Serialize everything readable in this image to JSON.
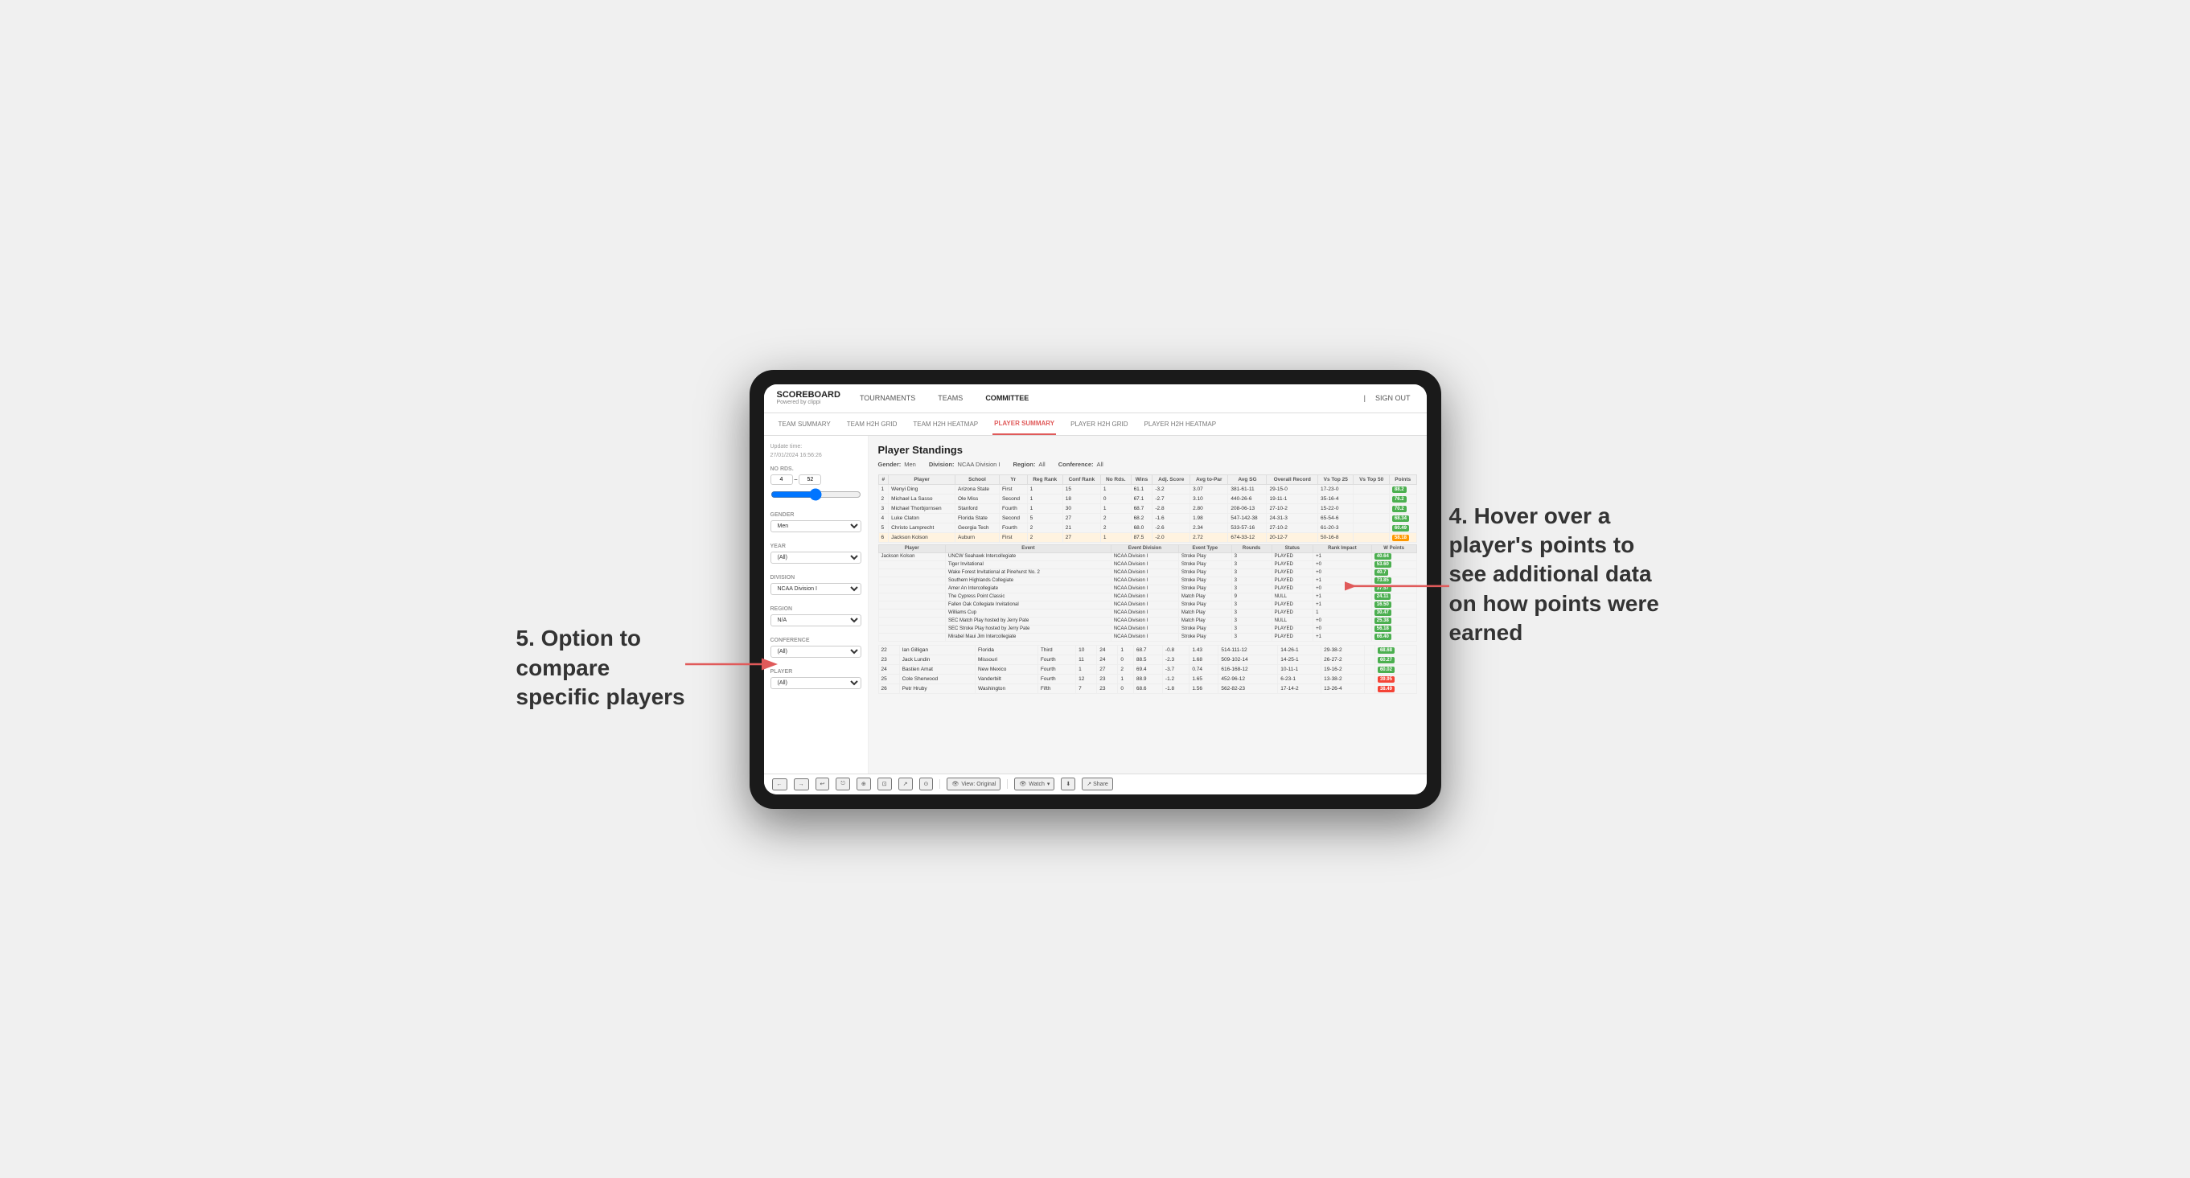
{
  "page": {
    "background": "#f0f0f0"
  },
  "annotation_right": {
    "text": "4. Hover over a player's points to see additional data on how points were earned"
  },
  "annotation_left": {
    "text": "5. Option to compare specific players"
  },
  "nav": {
    "logo": "SCOREBOARD",
    "logo_sub": "Powered by clippi",
    "links": [
      "TOURNAMENTS",
      "TEAMS",
      "COMMITTEE"
    ],
    "right": [
      "Sign out"
    ],
    "sign_in_icon": "|"
  },
  "sub_nav": {
    "links": [
      "TEAM SUMMARY",
      "TEAM H2H GRID",
      "TEAM H2H HEATMAP",
      "PLAYER SUMMARY",
      "PLAYER H2H GRID",
      "PLAYER H2H HEATMAP"
    ],
    "active": "PLAYER SUMMARY"
  },
  "sidebar": {
    "update_time_label": "Update time:",
    "update_time_value": "27/01/2024 16:56:26",
    "no_rds_label": "No Rds.",
    "rds_from": "4",
    "rds_to": "52",
    "gender_label": "Gender",
    "gender_value": "Men",
    "year_label": "Year",
    "year_value": "(All)",
    "division_label": "Division",
    "division_value": "NCAA Division I",
    "region_label": "Region",
    "region_value": "N/A",
    "conference_label": "Conference",
    "conference_value": "(All)",
    "player_label": "Player",
    "player_value": "(All)"
  },
  "standings": {
    "title": "Player Standings",
    "gender_label": "Gender:",
    "gender_value": "Men",
    "division_label": "Division:",
    "division_value": "NCAA Division I",
    "region_label": "Region:",
    "region_value": "All",
    "conference_label": "Conference:",
    "conference_value": "All",
    "columns": [
      "#",
      "Player",
      "School",
      "Yr",
      "Reg Rank",
      "Conf Rank",
      "No Rds.",
      "Wins",
      "Adj. Score",
      "Avg to-Par",
      "Avg SG",
      "Overall Record",
      "Vs Top 25",
      "Vs Top 50",
      "Points"
    ],
    "rows": [
      {
        "rank": "1",
        "player": "Wenyi Ding",
        "school": "Arizona State",
        "yr": "First",
        "reg_rank": "1",
        "conf_rank": "15",
        "no_rds": "1",
        "wins": "61.1",
        "adj_score": "-3.2",
        "to_par": "3.07",
        "avg_sg": "381-61-11",
        "vs25": "29-15-0",
        "vs50": "17-23-0",
        "points": "88.2"
      },
      {
        "rank": "2",
        "player": "Michael La Sasso",
        "school": "Ole Miss",
        "yr": "Second",
        "reg_rank": "1",
        "conf_rank": "18",
        "no_rds": "0",
        "wins": "67.1",
        "adj_score": "-2.7",
        "to_par": "3.10",
        "avg_sg": "440-26-6",
        "vs25": "19-11-1",
        "vs50": "35-16-4",
        "points": "76.2"
      },
      {
        "rank": "3",
        "player": "Michael Thorbjornsen",
        "school": "Stanford",
        "yr": "Fourth",
        "reg_rank": "1",
        "conf_rank": "30",
        "no_rds": "1",
        "wins": "68.7",
        "adj_score": "-2.8",
        "to_par": "2.80",
        "avg_sg": "208-06-13",
        "vs25": "27-10-2",
        "vs50": "15-22-0",
        "points": "70.2"
      },
      {
        "rank": "4",
        "player": "Luke Claton",
        "school": "Florida State",
        "yr": "Second",
        "reg_rank": "5",
        "conf_rank": "27",
        "no_rds": "2",
        "wins": "68.2",
        "adj_score": "-1.6",
        "to_par": "1.98",
        "avg_sg": "547-142-38",
        "vs25": "24-31-3",
        "vs50": "65-54-6",
        "points": "68.34"
      },
      {
        "rank": "5",
        "player": "Christo Lamprecht",
        "school": "Georgia Tech",
        "yr": "Fourth",
        "reg_rank": "2",
        "conf_rank": "21",
        "no_rds": "2",
        "wins": "68.0",
        "adj_score": "-2.6",
        "to_par": "2.34",
        "avg_sg": "533-57-16",
        "vs25": "27-10-2",
        "vs50": "61-20-3",
        "points": "60.49"
      },
      {
        "rank": "6",
        "player": "Jackson Kolson",
        "school": "Auburn",
        "yr": "First",
        "reg_rank": "2",
        "conf_rank": "27",
        "no_rds": "1",
        "wins": "87.5",
        "adj_score": "-2.0",
        "to_par": "2.72",
        "avg_sg": "674-33-12",
        "vs25": "20-12-7",
        "vs50": "50-16-8",
        "points": "58.18"
      }
    ],
    "detail_header": [
      "Player",
      "Event",
      "Event Division",
      "Event Type",
      "Rounds",
      "Status",
      "Rank Impact",
      "W Points"
    ],
    "detail_title": "Jackson Kolson",
    "detail_rows": [
      {
        "event": "UNCW Seahawk Intercollegiate",
        "division": "NCAA Division I",
        "type": "Stroke Play",
        "rounds": "3",
        "status": "PLAYED",
        "rank_impact": "+1",
        "points": "40.64"
      },
      {
        "event": "Tiger Invitational",
        "division": "NCAA Division I",
        "type": "Stroke Play",
        "rounds": "3",
        "status": "PLAYED",
        "rank_impact": "+0",
        "points": "53.60"
      },
      {
        "event": "Wake Forest Invitational at Pinehurst No. 2",
        "division": "NCAA Division I",
        "type": "Stroke Play",
        "rounds": "3",
        "status": "PLAYED",
        "rank_impact": "+0",
        "points": "40.7"
      },
      {
        "event": "Southern Highlands Collegiate",
        "division": "NCAA Division I",
        "type": "Stroke Play",
        "rounds": "3",
        "status": "PLAYED",
        "rank_impact": "+1",
        "points": "73.85"
      },
      {
        "event": "Amer An Intercollegiate",
        "division": "NCAA Division I",
        "type": "Stroke Play",
        "rounds": "3",
        "status": "PLAYED",
        "rank_impact": "+0",
        "points": "37.57"
      },
      {
        "event": "The Cypress Point Classic",
        "division": "NCAA Division I",
        "type": "Match Play",
        "rounds": "9",
        "status": "NULL",
        "rank_impact": "+1",
        "points": "24.11"
      },
      {
        "event": "Fallen Oak Collegiate Invitational",
        "division": "NCAA Division I",
        "type": "Stroke Play",
        "rounds": "3",
        "status": "PLAYED",
        "rank_impact": "+1",
        "points": "16.50"
      },
      {
        "event": "Williams Cup",
        "division": "NCAA Division I",
        "type": "Match Play",
        "rounds": "3",
        "status": "PLAYED",
        "rank_impact": "1",
        "points": "30.47"
      },
      {
        "event": "SEC Match Play hosted by Jerry Pate",
        "division": "NCAA Division I",
        "type": "Match Play",
        "rounds": "3",
        "status": "NULL",
        "rank_impact": "+0",
        "points": "25.38"
      },
      {
        "event": "SEC Stroke Play hosted by Jerry Pate",
        "division": "NCAA Division I",
        "type": "Stroke Play",
        "rounds": "3",
        "status": "PLAYED",
        "rank_impact": "+0",
        "points": "56.18"
      },
      {
        "event": "Mirabel Maui Jim Intercollegiate",
        "division": "NCAA Division I",
        "type": "Stroke Play",
        "rounds": "3",
        "status": "PLAYED",
        "rank_impact": "+1",
        "points": "66.40"
      }
    ],
    "more_rows": [
      {
        "rank": "22",
        "player": "Ian Gilligan",
        "school": "Florida",
        "yr": "Third",
        "reg_rank": "10",
        "conf_rank": "24",
        "no_rds": "1",
        "wins": "68.7",
        "adj_score": "-0.8",
        "to_par": "1.43",
        "avg_sg": "514-111-12",
        "vs25": "14-26-1",
        "vs50": "29-38-2",
        "points": "68.68"
      },
      {
        "rank": "23",
        "player": "Jack Lundin",
        "school": "Missouri",
        "yr": "Fourth",
        "reg_rank": "11",
        "conf_rank": "24",
        "no_rds": "0",
        "wins": "88.5",
        "adj_score": "-2.3",
        "to_par": "1.68",
        "avg_sg": "509-102-14",
        "vs25": "14-25-1",
        "vs50": "26-27-2",
        "points": "60.27"
      },
      {
        "rank": "24",
        "player": "Bastien Amat",
        "school": "New Mexico",
        "yr": "Fourth",
        "reg_rank": "1",
        "conf_rank": "27",
        "no_rds": "2",
        "wins": "69.4",
        "adj_score": "-3.7",
        "to_par": "0.74",
        "avg_sg": "616-168-12",
        "vs25": "10-11-1",
        "vs50": "19-16-2",
        "points": "60.02"
      },
      {
        "rank": "25",
        "player": "Cole Sherwood",
        "school": "Vanderbilt",
        "yr": "Fourth",
        "reg_rank": "12",
        "conf_rank": "23",
        "no_rds": "1",
        "wins": "88.9",
        "adj_score": "-1.2",
        "to_par": "1.65",
        "avg_sg": "452-96-12",
        "vs25": "6-23-1",
        "vs50": "13-38-2",
        "points": "39.95"
      },
      {
        "rank": "26",
        "player": "Petr Hruby",
        "school": "Washington",
        "yr": "Fifth",
        "reg_rank": "7",
        "conf_rank": "23",
        "no_rds": "0",
        "wins": "68.6",
        "adj_score": "-1.8",
        "to_par": "1.56",
        "avg_sg": "562-82-23",
        "vs25": "17-14-2",
        "vs50": "13-26-4",
        "points": "38.49"
      }
    ]
  },
  "toolbar": {
    "buttons": [
      "←",
      "→",
      "↩",
      "⎋",
      "⊕",
      "⊡",
      "↗",
      "⊙"
    ],
    "view_label": "View: Original",
    "watch_label": "Watch",
    "download_label": "↓",
    "share_label": "Share"
  }
}
